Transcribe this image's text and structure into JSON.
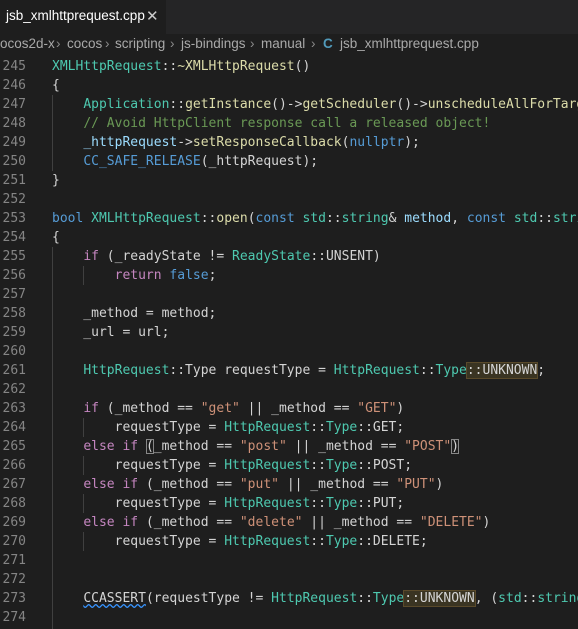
{
  "tab": {
    "label": "jsb_xmlhttprequest.cpp",
    "close": "✕"
  },
  "breadcrumb": {
    "parts": [
      "ocos2d-x",
      "cocos",
      "scripting",
      "js-bindings",
      "manual"
    ],
    "separator": "›",
    "file_icon": "C",
    "file": "jsb_xmlhttprequest.cpp"
  },
  "lines": [
    {
      "n": "245",
      "tokens": [
        {
          "t": "XMLHttpRequest",
          "c": "type"
        },
        {
          "t": "::",
          "c": "plain"
        },
        {
          "t": "~XMLHttpRequest",
          "c": "func"
        },
        {
          "t": "()",
          "c": "plain"
        }
      ]
    },
    {
      "n": "246",
      "tokens": [
        {
          "t": "{",
          "c": "plain"
        }
      ]
    },
    {
      "n": "247",
      "tokens": [
        {
          "t": "    ",
          "c": "plain"
        },
        {
          "t": "Application",
          "c": "type"
        },
        {
          "t": "::",
          "c": "plain"
        },
        {
          "t": "getInstance",
          "c": "func"
        },
        {
          "t": "()->",
          "c": "plain"
        },
        {
          "t": "getScheduler",
          "c": "func"
        },
        {
          "t": "()->",
          "c": "plain"
        },
        {
          "t": "unscheduleAllForTarge",
          "c": "func"
        }
      ]
    },
    {
      "n": "248",
      "tokens": [
        {
          "t": "    ",
          "c": "plain"
        },
        {
          "t": "// Avoid HttpClient response call a released object!",
          "c": "comment"
        }
      ]
    },
    {
      "n": "249",
      "tokens": [
        {
          "t": "    ",
          "c": "plain"
        },
        {
          "t": "_httpRequest",
          "c": "var"
        },
        {
          "t": "->",
          "c": "plain"
        },
        {
          "t": "setResponseCallback",
          "c": "func"
        },
        {
          "t": "(",
          "c": "plain"
        },
        {
          "t": "nullptr",
          "c": "kw"
        },
        {
          "t": ");",
          "c": "plain"
        }
      ]
    },
    {
      "n": "250",
      "tokens": [
        {
          "t": "    ",
          "c": "plain"
        },
        {
          "t": "CC_SAFE_RELEASE",
          "c": "macro"
        },
        {
          "t": "(_httpRequest);",
          "c": "plain"
        }
      ]
    },
    {
      "n": "251",
      "tokens": [
        {
          "t": "}",
          "c": "plain"
        }
      ]
    },
    {
      "n": "252",
      "tokens": []
    },
    {
      "n": "253",
      "tokens": [
        {
          "t": "bool ",
          "c": "kw"
        },
        {
          "t": "XMLHttpRequest",
          "c": "type"
        },
        {
          "t": "::",
          "c": "plain"
        },
        {
          "t": "open",
          "c": "func"
        },
        {
          "t": "(",
          "c": "plain"
        },
        {
          "t": "const ",
          "c": "kw"
        },
        {
          "t": "std",
          "c": "type"
        },
        {
          "t": "::",
          "c": "plain"
        },
        {
          "t": "string",
          "c": "type"
        },
        {
          "t": "& ",
          "c": "plain"
        },
        {
          "t": "method",
          "c": "var"
        },
        {
          "t": ", ",
          "c": "plain"
        },
        {
          "t": "const ",
          "c": "kw"
        },
        {
          "t": "std",
          "c": "type"
        },
        {
          "t": "::",
          "c": "plain"
        },
        {
          "t": "strin",
          "c": "type"
        }
      ]
    },
    {
      "n": "254",
      "tokens": [
        {
          "t": "{",
          "c": "plain"
        }
      ]
    },
    {
      "n": "255",
      "tokens": [
        {
          "t": "    ",
          "c": "plain"
        },
        {
          "t": "if",
          "c": "ctrl"
        },
        {
          "t": " (_readyState != ",
          "c": "plain"
        },
        {
          "t": "ReadyState",
          "c": "type"
        },
        {
          "t": "::UNSENT)",
          "c": "plain"
        }
      ]
    },
    {
      "n": "256",
      "tokens": [
        {
          "t": "        ",
          "c": "plain"
        },
        {
          "t": "return ",
          "c": "ctrl"
        },
        {
          "t": "false",
          "c": "kw"
        },
        {
          "t": ";",
          "c": "plain"
        }
      ]
    },
    {
      "n": "257",
      "tokens": []
    },
    {
      "n": "258",
      "tokens": [
        {
          "t": "    _method = method;",
          "c": "plain"
        }
      ]
    },
    {
      "n": "259",
      "tokens": [
        {
          "t": "    _url = url;",
          "c": "plain"
        }
      ]
    },
    {
      "n": "260",
      "tokens": []
    },
    {
      "n": "261",
      "tokens": [
        {
          "t": "    ",
          "c": "plain"
        },
        {
          "t": "HttpRequest",
          "c": "type"
        },
        {
          "t": "::Type requestType = ",
          "c": "plain"
        },
        {
          "t": "HttpRequest",
          "c": "type"
        },
        {
          "t": "::",
          "c": "plain"
        },
        {
          "t": "Type",
          "c": "type"
        },
        {
          "t": "::UNKNOWN",
          "c": "hlbg"
        },
        {
          "t": ";",
          "c": "plain"
        }
      ]
    },
    {
      "n": "262",
      "tokens": []
    },
    {
      "n": "263",
      "tokens": [
        {
          "t": "    ",
          "c": "plain"
        },
        {
          "t": "if",
          "c": "ctrl"
        },
        {
          "t": " (_method == ",
          "c": "plain"
        },
        {
          "t": "\"get\"",
          "c": "str"
        },
        {
          "t": " || _method == ",
          "c": "plain"
        },
        {
          "t": "\"GET\"",
          "c": "str"
        },
        {
          "t": ")",
          "c": "plain"
        }
      ]
    },
    {
      "n": "264",
      "tokens": [
        {
          "t": "        requestType = ",
          "c": "plain"
        },
        {
          "t": "HttpRequest",
          "c": "type"
        },
        {
          "t": "::",
          "c": "plain"
        },
        {
          "t": "Type",
          "c": "type"
        },
        {
          "t": "::GET;",
          "c": "plain"
        }
      ]
    },
    {
      "n": "265",
      "tokens": [
        {
          "t": "    ",
          "c": "plain"
        },
        {
          "t": "else if ",
          "c": "ctrl"
        },
        {
          "t": "(",
          "c": "hl"
        },
        {
          "t": "_method == ",
          "c": "plain"
        },
        {
          "t": "\"post\"",
          "c": "str"
        },
        {
          "t": " || _method == ",
          "c": "plain"
        },
        {
          "t": "\"POST\"",
          "c": "str"
        },
        {
          "t": ")",
          "c": "hl"
        }
      ]
    },
    {
      "n": "266",
      "tokens": [
        {
          "t": "        requestType = ",
          "c": "plain"
        },
        {
          "t": "HttpRequest",
          "c": "type"
        },
        {
          "t": "::",
          "c": "plain"
        },
        {
          "t": "Type",
          "c": "type"
        },
        {
          "t": "::POST;",
          "c": "plain"
        }
      ]
    },
    {
      "n": "267",
      "tokens": [
        {
          "t": "    ",
          "c": "plain"
        },
        {
          "t": "else if ",
          "c": "ctrl"
        },
        {
          "t": "(_method == ",
          "c": "plain"
        },
        {
          "t": "\"put\"",
          "c": "str"
        },
        {
          "t": " || _method == ",
          "c": "plain"
        },
        {
          "t": "\"PUT\"",
          "c": "str"
        },
        {
          "t": ")",
          "c": "plain"
        }
      ]
    },
    {
      "n": "268",
      "tokens": [
        {
          "t": "        requestType = ",
          "c": "plain"
        },
        {
          "t": "HttpRequest",
          "c": "type"
        },
        {
          "t": "::",
          "c": "plain"
        },
        {
          "t": "Type",
          "c": "type"
        },
        {
          "t": "::PUT;",
          "c": "plain"
        }
      ]
    },
    {
      "n": "269",
      "tokens": [
        {
          "t": "    ",
          "c": "plain"
        },
        {
          "t": "else if ",
          "c": "ctrl"
        },
        {
          "t": "(_method == ",
          "c": "plain"
        },
        {
          "t": "\"delete\"",
          "c": "str"
        },
        {
          "t": " || _method == ",
          "c": "plain"
        },
        {
          "t": "\"DELETE\"",
          "c": "str"
        },
        {
          "t": ")",
          "c": "plain"
        }
      ]
    },
    {
      "n": "270",
      "tokens": [
        {
          "t": "        requestType = ",
          "c": "plain"
        },
        {
          "t": "HttpRequest",
          "c": "type"
        },
        {
          "t": "::",
          "c": "plain"
        },
        {
          "t": "Type",
          "c": "type"
        },
        {
          "t": "::DELETE;",
          "c": "plain"
        }
      ]
    },
    {
      "n": "271",
      "tokens": []
    },
    {
      "n": "272",
      "tokens": []
    },
    {
      "n": "273",
      "tokens": [
        {
          "t": "    ",
          "c": "plain"
        },
        {
          "t": "CCASSERT",
          "c": "squig"
        },
        {
          "t": "(requestType != ",
          "c": "plain"
        },
        {
          "t": "HttpRequest",
          "c": "type"
        },
        {
          "t": "::",
          "c": "plain"
        },
        {
          "t": "Type",
          "c": "type"
        },
        {
          "t": "::UNKNOWN",
          "c": "hlbg"
        },
        {
          "t": ", (",
          "c": "plain"
        },
        {
          "t": "std",
          "c": "type"
        },
        {
          "t": "::",
          "c": "plain"
        },
        {
          "t": "stringe",
          "c": "type"
        }
      ]
    },
    {
      "n": "274",
      "tokens": []
    }
  ]
}
